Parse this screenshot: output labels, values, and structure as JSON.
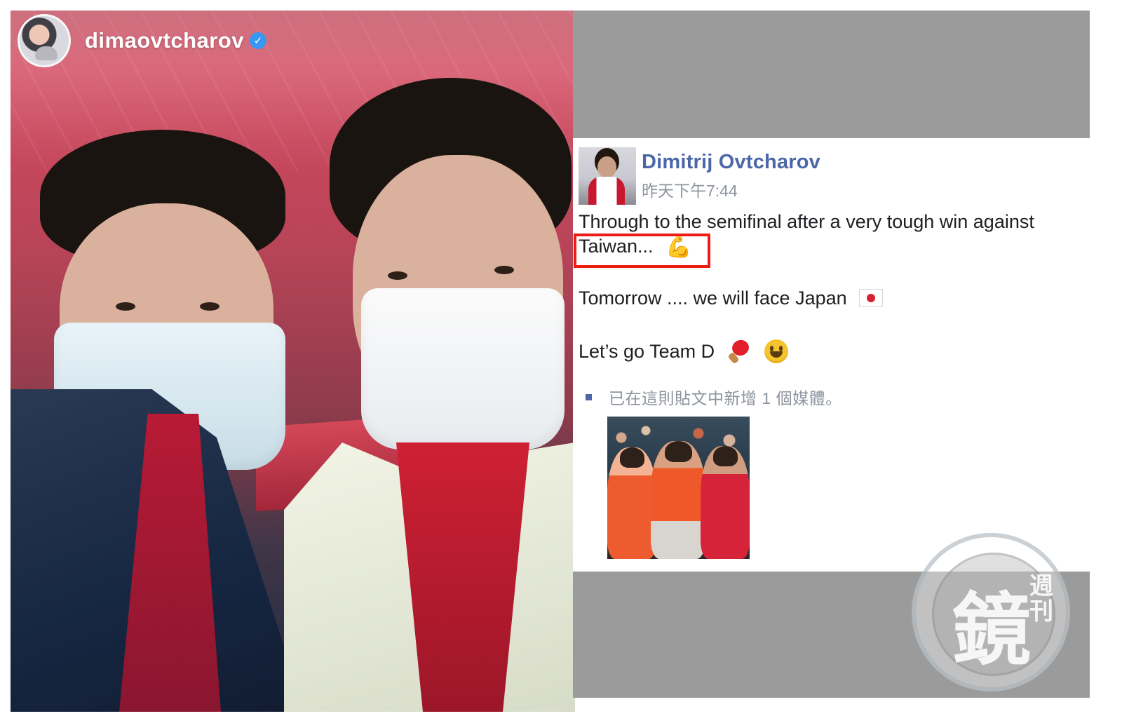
{
  "instagram": {
    "username": "dimaovtcharov"
  },
  "facebook_post": {
    "author": "Dimitrij Ovtcharov",
    "time": "昨天下午7:44",
    "lines": [
      "Through to the semifinal after a very tough win against",
      "Taiwan...",
      "Tomorrow .... we will face Japan",
      "Let’s go Team D"
    ],
    "emoji": {
      "flex": "flexed-biceps-icon",
      "japan": "japan-flag-icon",
      "ping_pong": "ping-pong-paddle-icon",
      "smile": "grinning-face-icon"
    },
    "media_note": "已在這則貼文中新增 1 個媒體。"
  },
  "watermark": {
    "main_glyph": "鏡",
    "side_glyphs": "週\n刊"
  },
  "colors": {
    "facebook_name": "#4b67a8",
    "highlight_border": "#ee1c12",
    "gray_block": "#9b9b9b"
  }
}
